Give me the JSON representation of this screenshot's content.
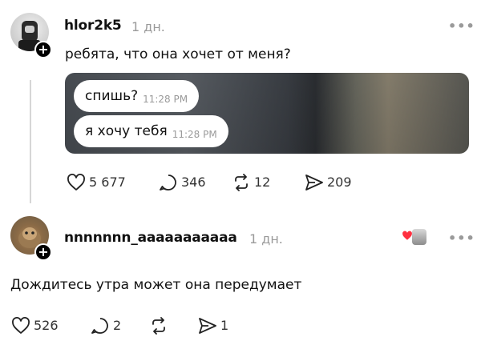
{
  "post": {
    "username": "hlor2k5",
    "time": "1 дн.",
    "text": "ребята, что она хочет от меня?",
    "follow_icon": "plus-icon",
    "image": {
      "messages": [
        {
          "text": "спишь?",
          "time": "11:28 PM"
        },
        {
          "text": "я хочу тебя",
          "time": "11:28 PM"
        }
      ]
    },
    "actions": {
      "likes": "5 677",
      "comments": "346",
      "reposts": "12",
      "shares": "209"
    }
  },
  "reply": {
    "username": "nnnnnnn_aaaaaaaaaaa",
    "time": "1 дн.",
    "text": "Дождитесь утра может она передумает",
    "liked_by_author_color": "#ff3040",
    "actions": {
      "likes": "526",
      "comments": "2",
      "reposts": "",
      "shares": "1"
    }
  },
  "colors": {
    "muted": "#9a9a9a",
    "text": "#111111",
    "thread_line": "#d6d6d6"
  }
}
